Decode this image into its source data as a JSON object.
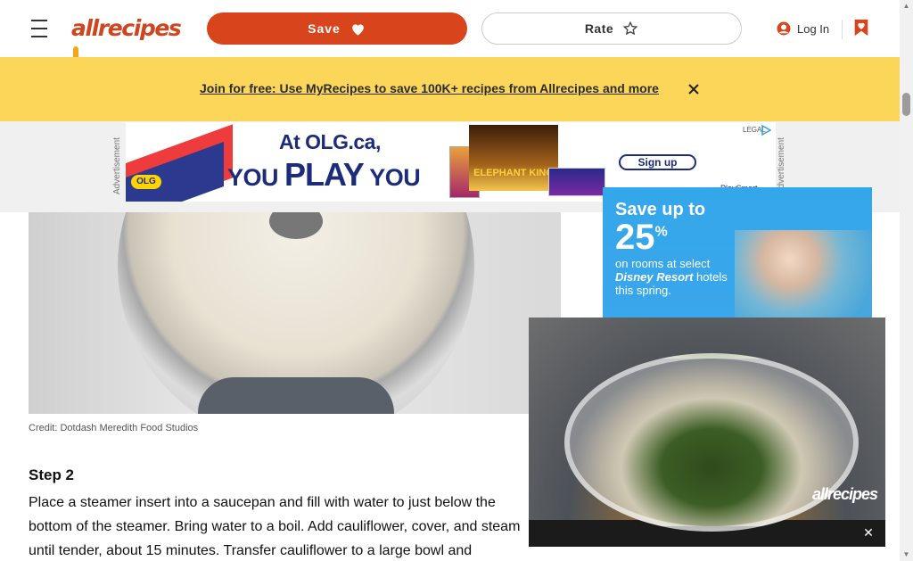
{
  "header": {
    "logo_text": "allrecipes",
    "save_label": "Save",
    "rate_label": "Rate",
    "login_label": "Log In"
  },
  "promo": {
    "text": "Join for free: Use MyRecipes to save 100K+ recipes from Allrecipes and more"
  },
  "ads": {
    "label": "Advertisement",
    "olg": {
      "line1": "At OLG.ca,",
      "line2_pre": "YOU",
      "line2_bold": "PLAY",
      "line2_post": "YOU",
      "cta": "Sign up",
      "playsmart": "PlaySmart",
      "legal": "LEGAL",
      "logo": "OLG",
      "game_title": "ELEPHANT KING"
    },
    "disney": {
      "headline": "Save up to",
      "amount": "25",
      "percent": "%",
      "sub_pre": "on rooms at select",
      "sub_brand": "Disney Resort",
      "sub_post": "hotels this spring."
    }
  },
  "article": {
    "image_credit": "Credit: Dotdash Meredith Food Studios",
    "step_title": "Step 2",
    "step_text": "Place a steamer insert into a saucepan and fill with water to just below the bottom of the steamer. Bring water to a boil. Add cauliflower, cover, and steam until tender, about 15 minutes. Transfer cauliflower to a large bowl and"
  },
  "video": {
    "watermark": "allrecipes"
  },
  "colors": {
    "brand_orange": "#d8441c",
    "promo_yellow": "#fcd659"
  }
}
